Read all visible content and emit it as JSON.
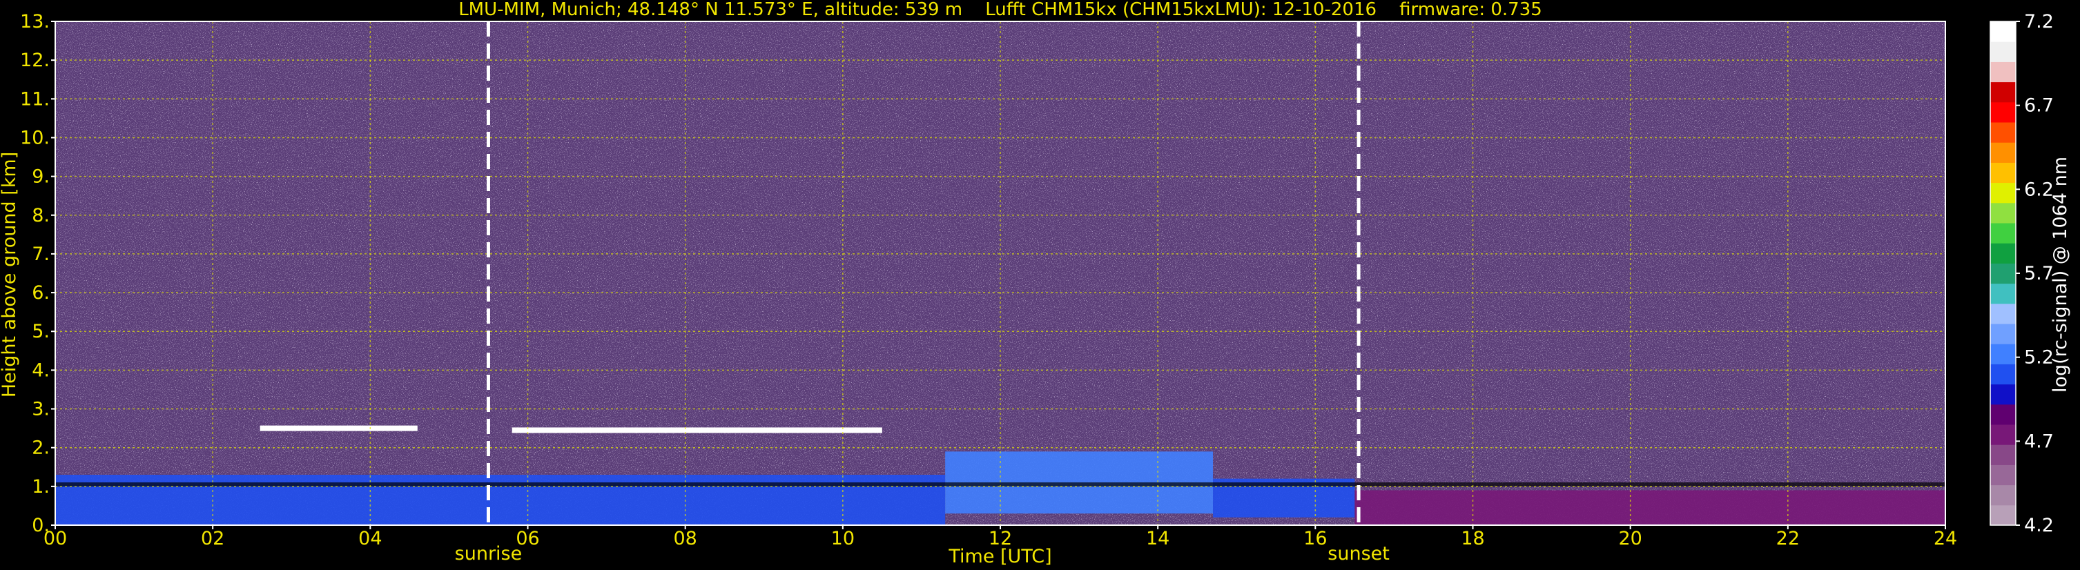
{
  "chart_data": {
    "type": "heatmap",
    "title": "LMU-MIM, Munich; 48.148° N 11.573° E, altitude: 539 m    Lufft CHM15kx (CHM15kxLMU): 12-10-2016    firmware: 0.735",
    "xlabel": "Time [UTC]",
    "ylabel": "Height above ground [km]",
    "xlim": [
      0,
      24
    ],
    "ylim": [
      0,
      13
    ],
    "xticks": [
      "00",
      "02",
      "04",
      "06",
      "08",
      "10",
      "12",
      "14",
      "16",
      "18",
      "20",
      "22",
      "24"
    ],
    "yticks": [
      "0.",
      "1.",
      "2.",
      "3.",
      "4.",
      "5.",
      "6.",
      "7.",
      "8.",
      "9.",
      "10.",
      "11.",
      "12.",
      "13."
    ],
    "grid": true,
    "markers": [
      {
        "label": "sunrise",
        "x": 5.5
      },
      {
        "label": "sunset",
        "x": 16.55
      }
    ],
    "colorbar": {
      "label": "log(rc-signal) @ 1064 nm",
      "range": [
        4.2,
        7.2
      ],
      "ticks": [
        "4.2",
        "4.7",
        "5.2",
        "5.7",
        "6.2",
        "6.7",
        "7.2"
      ],
      "colors": [
        "#b8a0b8",
        "#a888a8",
        "#986898",
        "#884888",
        "#781878",
        "#600070",
        "#1010c8",
        "#2050f0",
        "#4080ff",
        "#70a0ff",
        "#a0c0ff",
        "#40c0c0",
        "#20a070",
        "#10a040",
        "#40d040",
        "#90e040",
        "#e0f000",
        "#ffc000",
        "#ff9000",
        "#ff5000",
        "#ff0000",
        "#d00000",
        "#f0c0c0",
        "#f0f0f0",
        "#ffffff"
      ]
    },
    "layers": [
      {
        "kind": "noise",
        "y_range": [
          2.8,
          13
        ],
        "color": "#6a4a8a"
      },
      {
        "kind": "aerosol_layer",
        "x_range": [
          0,
          11.3
        ],
        "y_range": [
          0,
          1.3
        ],
        "color": "#2050f0"
      },
      {
        "kind": "aerosol_layer",
        "x_range": [
          11.3,
          14.7
        ],
        "y_range": [
          0.3,
          1.9
        ],
        "color": "#4080ff"
      },
      {
        "kind": "aerosol_layer",
        "x_range": [
          14.7,
          16.5
        ],
        "y_range": [
          0.2,
          1.2
        ],
        "color": "#2050f0"
      },
      {
        "kind": "aerosol_layer",
        "x_range": [
          16.5,
          24
        ],
        "y_range": [
          0,
          0.9
        ],
        "color": "#781878"
      },
      {
        "kind": "cloud_band",
        "x_range": [
          2.6,
          4.6
        ],
        "y_range": [
          2.4,
          2.6
        ],
        "color": "#ffffff"
      },
      {
        "kind": "cloud_band",
        "x_range": [
          5.8,
          10.5
        ],
        "y_range": [
          2.2,
          2.7
        ],
        "color": "#ffffff"
      },
      {
        "kind": "cloud_base",
        "x_range": [
          0,
          24
        ],
        "y_range": [
          0.9,
          1.2
        ],
        "color": "#000000"
      }
    ]
  }
}
